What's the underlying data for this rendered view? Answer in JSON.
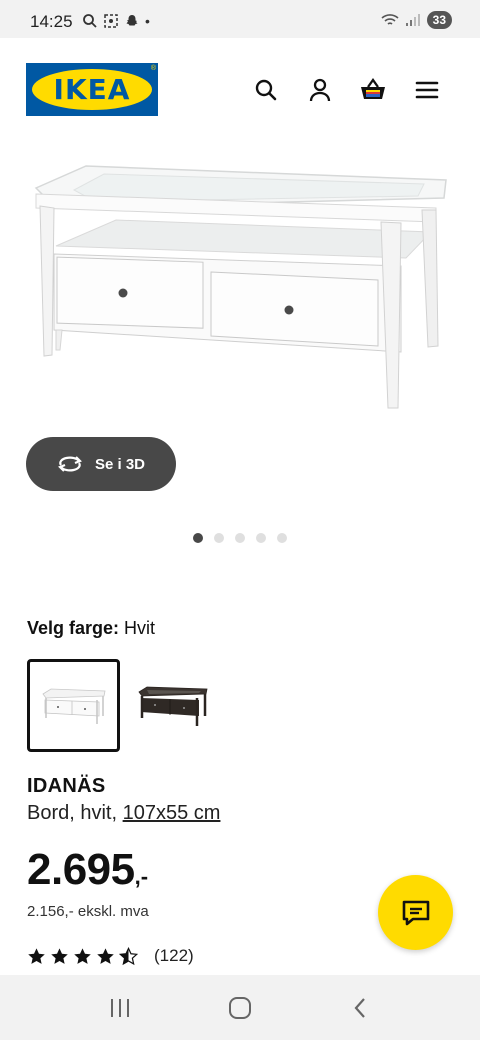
{
  "status_bar": {
    "time": "14:25",
    "battery": "33"
  },
  "header": {
    "logo_text": "IKEA",
    "brand_blue": "#0058a3",
    "brand_yellow": "#ffdb00",
    "icons": [
      "search-icon",
      "account-icon",
      "basket-icon",
      "menu-icon"
    ]
  },
  "gallery": {
    "view_3d_label": "Se i 3D",
    "image_count": 5,
    "active_index": 0
  },
  "color_selector": {
    "label": "Velg farge:",
    "selected_value": "Hvit",
    "options": [
      "Hvit",
      "Mørkebrun"
    ]
  },
  "product": {
    "name": "IDANÄS",
    "description": "Bord, hvit,",
    "size": "107x55 cm",
    "price": "2.695",
    "price_suffix": ",-",
    "price_ex_vat": "2.156,- ekskl. mva",
    "rating": 4.5,
    "review_count": "(122)"
  }
}
